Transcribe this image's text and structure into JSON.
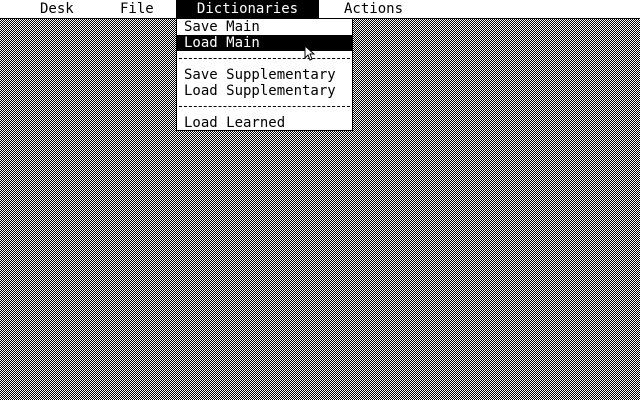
{
  "menubar": {
    "desk": "Desk",
    "file": "File",
    "dictionaries": "Dictionaries",
    "actions": "Actions"
  },
  "dictionaries_menu": {
    "items": [
      {
        "label": "Save Main"
      },
      {
        "label": "Load Main",
        "highlighted": true
      },
      {
        "label": "Save Supplementary"
      },
      {
        "label": "Load Supplementary"
      },
      {
        "label": "Load Learned"
      }
    ]
  },
  "icons": {
    "cursor": "arrow-pointer-icon"
  }
}
